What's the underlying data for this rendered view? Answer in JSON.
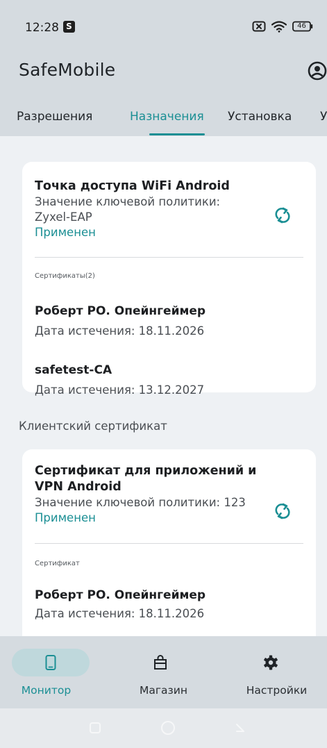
{
  "status_bar": {
    "time": "12:28",
    "app_badge": "S",
    "battery": "46"
  },
  "app_bar": {
    "title": "SafeMobile"
  },
  "tabs": [
    {
      "label": "Разрешения",
      "active": false
    },
    {
      "label": "Назначения",
      "active": true
    },
    {
      "label": "Установка",
      "active": false
    },
    {
      "label": "У",
      "active": false
    }
  ],
  "cards": [
    {
      "title": "Точка доступа WiFi Android",
      "policy_line1": "Значение ключевой политики:",
      "policy_line2": "Zyxel-EAP",
      "status": "Применен",
      "certs_label": "Сертификаты(2)",
      "certs": [
        {
          "name": "Роберт РО. Опейнгеймер",
          "expiry": "Дата истечения: 18.11.2026"
        },
        {
          "name": "safetest-CA",
          "expiry": "Дата истечения: 13.12.2027"
        }
      ]
    },
    {
      "title_line1": "Сертификат для приложений и",
      "title_line2": "VPN Android",
      "policy": "Значение ключевой политики: 123",
      "status": "Применен",
      "certs_label": "Сертификат",
      "certs": [
        {
          "name": "Роберт РО. Опейнгеймер",
          "expiry": "Дата истечения: 18.11.2026"
        }
      ]
    }
  ],
  "section_label": "Клиентский сертификат",
  "bottom_nav": [
    {
      "label": "Монитор",
      "icon": "phone-icon",
      "active": true
    },
    {
      "label": "Магазин",
      "icon": "shopping-bag-icon",
      "active": false
    },
    {
      "label": "Настройки",
      "icon": "gear-icon",
      "active": false
    }
  ],
  "colors": {
    "accent": "#1b8f94",
    "bar_background": "#d5dbe0",
    "page_background": "#eef1f4",
    "card_background": "#ffffff",
    "active_pill": "#bfd8dc"
  }
}
